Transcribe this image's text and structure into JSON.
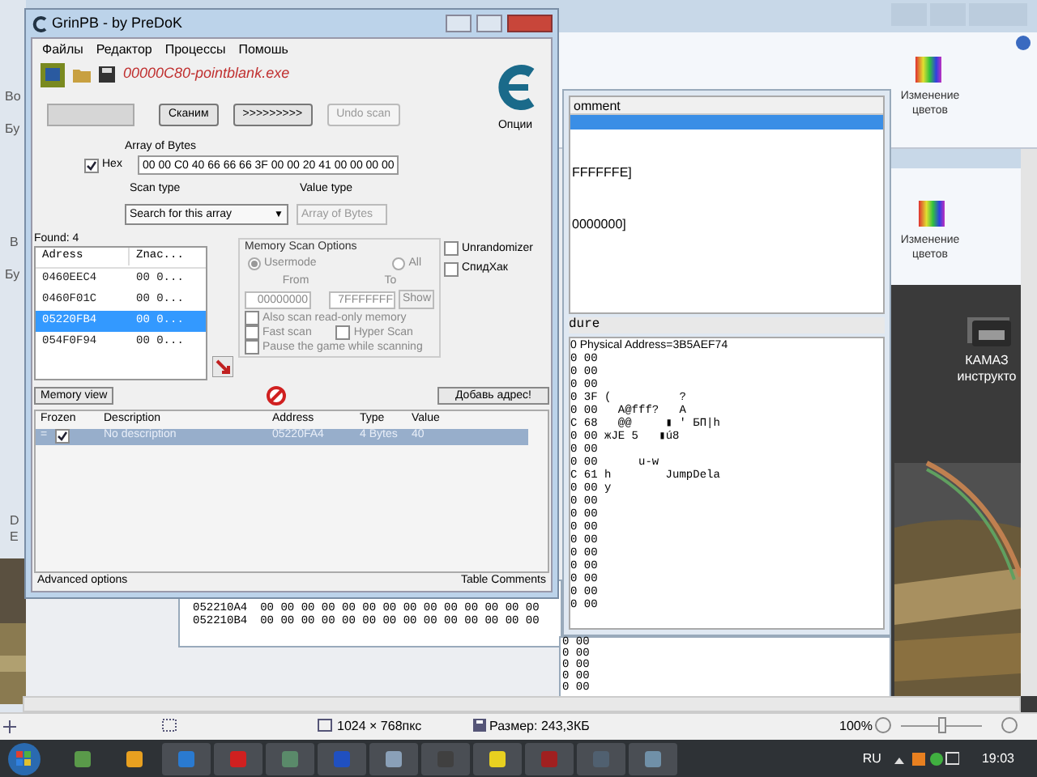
{
  "left_fragments": [
    "Во",
    "Бу",
    "В",
    "Бу",
    "D",
    "E"
  ],
  "paint_top": {
    "ribbon_label": "Изменение цветов"
  },
  "paint_second": {
    "ribbon_label": "Изменение цветов"
  },
  "desktop_icon": {
    "label": "КАМАЗ инструкто"
  },
  "memory_viewer": {
    "column": "omment",
    "rows": [
      {
        "text": "",
        "selected": true
      },
      {
        "text": "FFFFFFE]",
        "selected": false
      },
      {
        "text": "0000000]",
        "selected": false
      }
    ],
    "section": "dure",
    "info": "0 Physical Address=3B5AEF74",
    "lines": [
      "0 00",
      "0 00",
      "0 00",
      "0 3F (          ?",
      "0 00   A@fff?   A",
      "C 68   @@     ▮ ' БП|h",
      "0 00 жJE 5   ▮ú8",
      "0 00",
      "0 00      u-w",
      "C 61 h        JumpDela",
      "0 00 y",
      "0 00",
      "0 00",
      "0 00",
      "0 00",
      "0 00",
      "0 00",
      "0 00",
      "0 00",
      "0 00"
    ]
  },
  "hex_window": {
    "rows": [
      {
        "address": "052210A4",
        "bytes": "00 00 00 00 00 00 00 00 00 00 00 00 00 00"
      },
      {
        "address": "052210B4",
        "bytes": "00 00 00 00 00 00 00 00 00 00 00 00 00 00"
      }
    ]
  },
  "back_lines": [
    "0 00",
    "0 00",
    "0 00",
    "0 00",
    "0 00"
  ],
  "ce": {
    "title": "GrinPB - by PreDoK",
    "menu": [
      "Файлы",
      "Редактор",
      "Процессы",
      "Помошь"
    ],
    "process": "00000C80-pointblank.exe",
    "options_label": "Опции",
    "progress": {
      "level": 0
    },
    "scan_buttons": [
      {
        "label": "Сканим",
        "disabled": false
      },
      {
        "label": ">>>>>>>>>",
        "disabled": false
      },
      {
        "label": "Undo scan",
        "disabled": true
      }
    ],
    "value_label": "Array of Bytes",
    "hex": {
      "label": "Hex",
      "checked": true
    },
    "value": "00 00 C0 40 66 66 66 3F 00 00 20 41 00 00 00 00",
    "scan_type": {
      "label": "Scan type",
      "value": "Search for this array",
      "caret": "▼",
      "disabled": false
    },
    "value_type": {
      "label": "Value type",
      "value": "Array of Bytes",
      "disabled": true
    },
    "found": "Found: 4",
    "columns": [
      "Adress",
      "Znac..."
    ],
    "results": [
      {
        "address": "0460EEC4",
        "value": "00 0...",
        "selected": false
      },
      {
        "address": "0460F01C",
        "value": "00 0...",
        "selected": false
      },
      {
        "address": "05220FB4",
        "value": "00 0...",
        "selected": true
      },
      {
        "address": "054F0F94",
        "value": "00 0...",
        "selected": false
      }
    ],
    "mem_options": {
      "title": "Memory Scan Options",
      "radios": [
        {
          "label": "Usermode",
          "selected": true
        },
        {
          "label": "All",
          "selected": false
        }
      ],
      "from_label": "From",
      "to_label": "To",
      "from": "00000000",
      "to": "7FFFFFFF",
      "show": "Show",
      "checks": [
        {
          "label": "Also scan read-only memory",
          "checked": false
        },
        {
          "label": "Fast scan",
          "checked": false
        },
        {
          "label": "Hyper Scan",
          "checked": false
        },
        {
          "label": "Pause the game while scanning",
          "checked": false
        }
      ]
    },
    "side_checks": [
      {
        "label": "Unrandomizer",
        "checked": false
      },
      {
        "label": "СпидХак",
        "checked": false
      }
    ],
    "memory_view_button": "Memory view",
    "add_button": "Добавь адрес!",
    "table": {
      "columns": [
        "Frozen",
        "Description",
        "Address",
        "Type",
        "Value"
      ],
      "rows": [
        {
          "frozen_mark": "=",
          "checked": true,
          "description": "No description",
          "address": "05220FA4",
          "type": "4 Bytes",
          "value": "40",
          "selected": true
        }
      ]
    },
    "advanced": "Advanced options",
    "comments": "Table Comments"
  },
  "status": {
    "size_px": "1024 × 768пкс",
    "file_size": "Размер: 243,3КБ",
    "zoom": "100%",
    "zoom_slider": {
      "level": 0.5
    }
  },
  "taskbar": {
    "language": "RU",
    "time": "19:03",
    "apps": [
      {
        "color": "#5a9a4a"
      },
      {
        "color": "#e8a020"
      },
      {
        "color": "#2a7ad0"
      },
      {
        "color": "#d02020"
      },
      {
        "color": "#5a8a6a"
      },
      {
        "color": "#2050c0"
      },
      {
        "color": "#8aa0b8"
      },
      {
        "color": "#404040"
      },
      {
        "color": "#e8d020"
      },
      {
        "color": "#a02020"
      },
      {
        "color": "#506070"
      },
      {
        "color": "#7090a8"
      }
    ]
  }
}
